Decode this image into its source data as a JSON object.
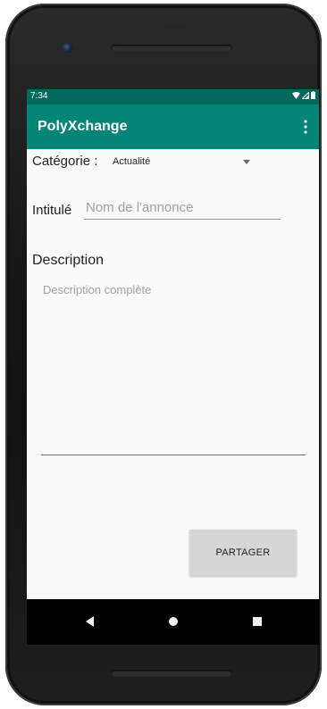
{
  "status_bar": {
    "time": "7:34",
    "icons": [
      "wifi-icon",
      "signal-icon",
      "battery-icon"
    ]
  },
  "app_bar": {
    "title": "PolyXchange",
    "menu_icon": "overflow-menu-icon"
  },
  "form": {
    "category_label": "Catégorie :",
    "category_selected": "Actualité",
    "title_label": "Intitulé",
    "title_placeholder": "Nom de l'annonce",
    "title_value": "",
    "description_label": "Description",
    "description_placeholder": "Description complète",
    "description_value": "",
    "share_button_label": "PARTAGER"
  },
  "nav_bar": {
    "buttons": [
      "back-icon",
      "home-icon",
      "recents-icon"
    ]
  },
  "colors": {
    "status_bar": "#00695c",
    "app_bar": "#008577",
    "button": "#d6d6d6"
  }
}
